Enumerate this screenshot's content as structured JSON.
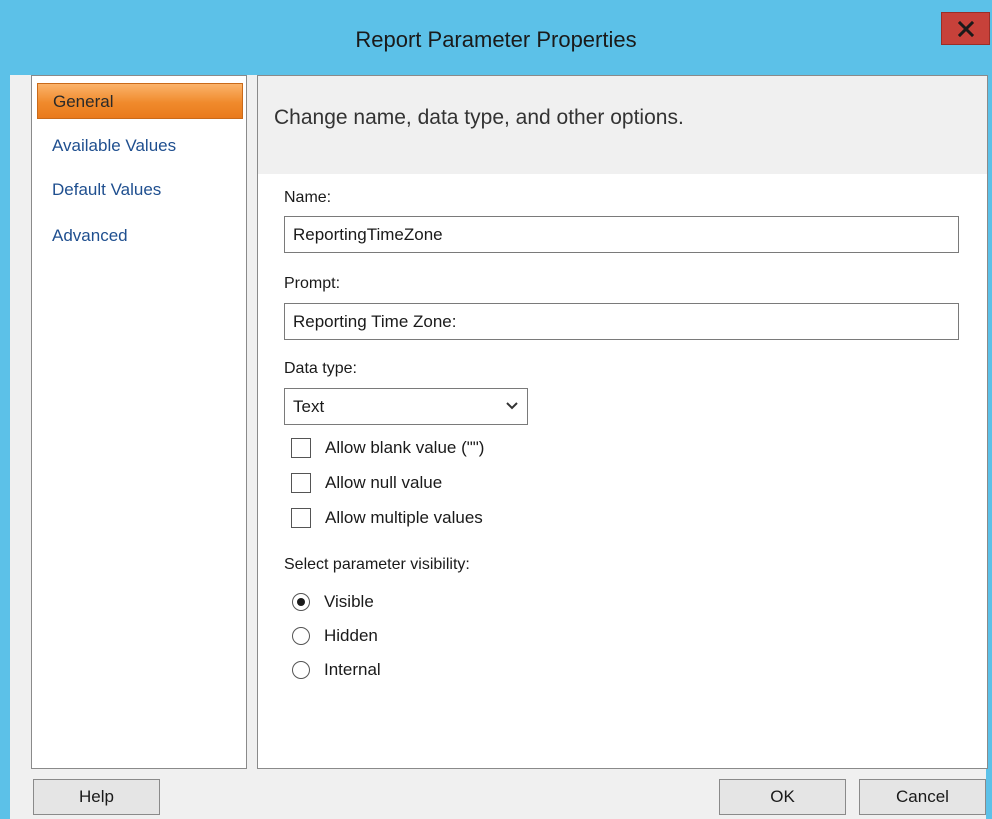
{
  "window": {
    "title": "Report Parameter Properties",
    "close_icon": "close-icon",
    "accent_color": "#5cc1e8",
    "close_color": "#c7413a"
  },
  "sidebar": {
    "items": [
      {
        "label": "General",
        "active": true
      },
      {
        "label": "Available Values",
        "active": false
      },
      {
        "label": "Default Values",
        "active": false
      },
      {
        "label": "Advanced",
        "active": false
      }
    ]
  },
  "main": {
    "header": "Change name, data type, and other options.",
    "name_label": "Name:",
    "name_value": "ReportingTimeZone",
    "prompt_label": "Prompt:",
    "prompt_value": "Reporting Time Zone:",
    "data_type_label": "Data type:",
    "data_type_value": "Text",
    "checkboxes": [
      {
        "label": "Allow blank value (\"\")",
        "checked": false
      },
      {
        "label": "Allow null value",
        "checked": false
      },
      {
        "label": "Allow multiple values",
        "checked": false
      }
    ],
    "visibility_label": "Select parameter visibility:",
    "visibility_options": [
      {
        "label": "Visible",
        "selected": true
      },
      {
        "label": "Hidden",
        "selected": false
      },
      {
        "label": "Internal",
        "selected": false
      }
    ]
  },
  "footer": {
    "help_label": "Help",
    "ok_label": "OK",
    "cancel_label": "Cancel"
  }
}
